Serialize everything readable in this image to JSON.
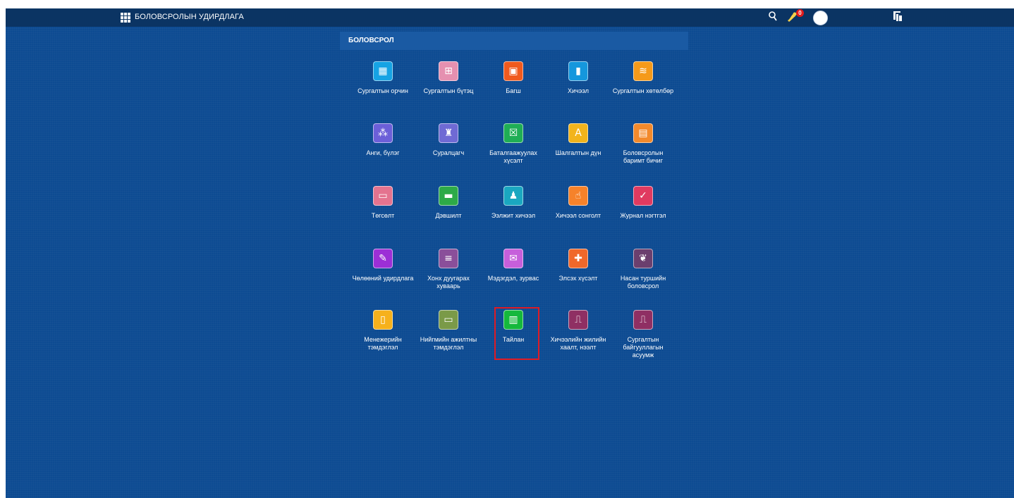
{
  "topbar": {
    "app_title": "БОЛОВСРОЛЫН УДИРДЛАГА",
    "notification_count": "0"
  },
  "section": {
    "title": "БОЛОВСРОЛ"
  },
  "tiles": [
    {
      "label": "Сургалтын орчин",
      "icon": "building-icon",
      "color": "#16a3e4"
    },
    {
      "label": "Сургалтын бүтэц",
      "icon": "org-chart-icon",
      "color": "#e590b0"
    },
    {
      "label": "Багш",
      "icon": "teacher-board-icon",
      "color": "#f05a1e"
    },
    {
      "label": "Хичээл",
      "icon": "book-icon",
      "color": "#1597dd"
    },
    {
      "label": "Сургалтын хөтөлбөр",
      "icon": "books-stack-icon",
      "color": "#f59a1a"
    },
    {
      "label": "Анги, бүлэг",
      "icon": "class-group-icon",
      "color": "#6c5fd8"
    },
    {
      "label": "Суралцагч",
      "icon": "student-icon",
      "color": "#6f6ad4"
    },
    {
      "label": "Баталгаажуулах хүсэлт",
      "icon": "approval-icon",
      "color": "#1fae55"
    },
    {
      "label": "Шалгалтын дүн",
      "icon": "exam-grade-icon",
      "color": "#f2b41c"
    },
    {
      "label": "Боловсролын баримт бичиг",
      "icon": "document-icon",
      "color": "#f38a2c"
    },
    {
      "label": "Төгсөлт",
      "icon": "graduation-board-icon",
      "color": "#e4738f"
    },
    {
      "label": "Дэвшилт",
      "icon": "promotion-board-icon",
      "color": "#2daa48"
    },
    {
      "label": "Ээлжит хичээл",
      "icon": "reading-student-icon",
      "color": "#1aa7c0"
    },
    {
      "label": "Хичээл сонголт",
      "icon": "selection-hand-icon",
      "color": "#f6822a"
    },
    {
      "label": "Журнал нэгтгэл",
      "icon": "journal-check-icon",
      "color": "#e03a60"
    },
    {
      "label": "Чөлөөний удирдлага",
      "icon": "leave-edit-icon",
      "color": "#9c2fd6"
    },
    {
      "label": "Хонх дуугарах хуваарь",
      "icon": "bell-schedule-icon",
      "color": "#8a4f9a"
    },
    {
      "label": "Мэдэгдэл, зурвас",
      "icon": "message-icon",
      "color": "#c65fdb"
    },
    {
      "label": "Элсэх хүсэлт",
      "icon": "enrollment-icon",
      "color": "#f0682a"
    },
    {
      "label": "Насан туршийн боловсрол",
      "icon": "lifelong-learning-icon",
      "color": "#6b3f6e"
    },
    {
      "label": "Менежерийн тэмдэглэл",
      "icon": "manager-note-icon",
      "color": "#f6b11c"
    },
    {
      "label": "Нийгмийн ажилтны тэмдэглэл",
      "icon": "social-worker-note-icon",
      "color": "#7a9a48"
    },
    {
      "label": "Тайлан",
      "icon": "report-icon",
      "color": "#15b83c"
    },
    {
      "label": "Хичээлийн жилийн хаалт, нээлт",
      "icon": "door-exit-icon",
      "color": "#8f2f63"
    },
    {
      "label": "Сургалтын байгууллагын асуумж",
      "icon": "door-exit-icon",
      "color": "#8f2f63"
    }
  ]
}
